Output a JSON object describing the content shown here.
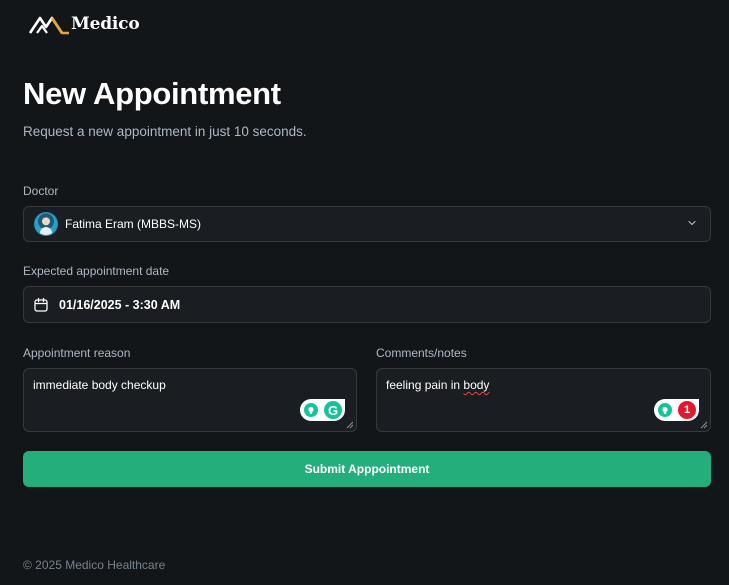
{
  "brand": {
    "name": "Medico",
    "logo_icon": "mountain-logo-icon",
    "accent_color": "#24ae7c"
  },
  "header": {
    "title": "New Appointment",
    "subtitle": "Request a new appointment in just 10 seconds."
  },
  "form": {
    "doctor": {
      "label": "Doctor",
      "selected": "Fatima Eram (MBBS-MS)",
      "icon": "chevron-down-icon"
    },
    "date": {
      "label": "Expected appointment date",
      "value": "01/16/2025 - 3:30 AM",
      "icon": "calendar-icon"
    },
    "reason": {
      "label": "Appointment reason",
      "value": "immediate body checkup"
    },
    "notes": {
      "label": "Comments/notes",
      "value_prefix": "feeling pain in ",
      "value_misspelled": "body",
      "grammarly_issue_count": "1"
    },
    "submit_label": "Submit Apppointment"
  },
  "footer": {
    "copyright": "© 2025 Medico Healthcare"
  }
}
